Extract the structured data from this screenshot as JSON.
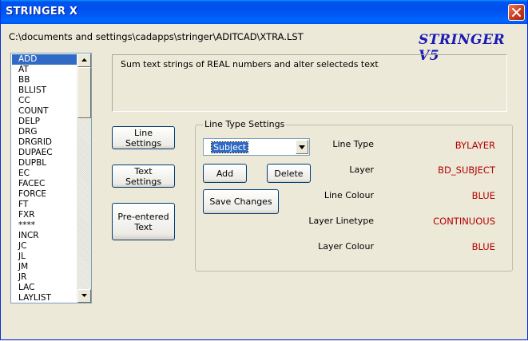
{
  "window": {
    "title": "STRINGER X"
  },
  "header": {
    "file_path": "C:\\documents and settings\\cadapps\\stringer\\ADITCAD\\XTRA.LST",
    "brand": "STRINGER V5"
  },
  "command_list": {
    "items": [
      "ADD",
      "AT",
      "BB",
      "BLLIST",
      "CC",
      "COUNT",
      "DELP",
      "DRG",
      "DRGRID",
      "DUPAEC",
      "DUPBL",
      "EC",
      "FACEC",
      "FORCE",
      "FT",
      "FXR",
      "****",
      "INCR",
      "JC",
      "JL",
      "JM",
      "JR",
      "LAC",
      "LAYLIST"
    ],
    "selected": "ADD"
  },
  "description": "Sum text strings of REAL numbers and alter selecteds text",
  "buttons": {
    "line_settings": "Line Settings",
    "text_settings": "Text Settings",
    "pre_entered_text": "Pre-entered Text",
    "add": "Add",
    "delete": "Delete",
    "save_changes": "Save Changes"
  },
  "line_type_settings": {
    "legend": "Line Type Settings",
    "selected_type": "Subject",
    "properties": [
      {
        "label": "Line Type",
        "value": "BYLAYER"
      },
      {
        "label": "Layer",
        "value": "BD_SUBJECT"
      },
      {
        "label": "Line Colour",
        "value": "BLUE"
      },
      {
        "label": "Layer Linetype",
        "value": "CONTINUOUS"
      },
      {
        "label": "Layer Colour",
        "value": "BLUE"
      }
    ]
  },
  "colors": {
    "title_bar": "#0054e3",
    "value_text": "#b40000",
    "brand_text": "#1a1ab4",
    "selection": "#316ac5"
  },
  "icons": {
    "close": "close-icon",
    "scroll_up": "arrow-up-icon",
    "scroll_down": "arrow-down-icon",
    "dropdown": "chevron-down-icon"
  }
}
